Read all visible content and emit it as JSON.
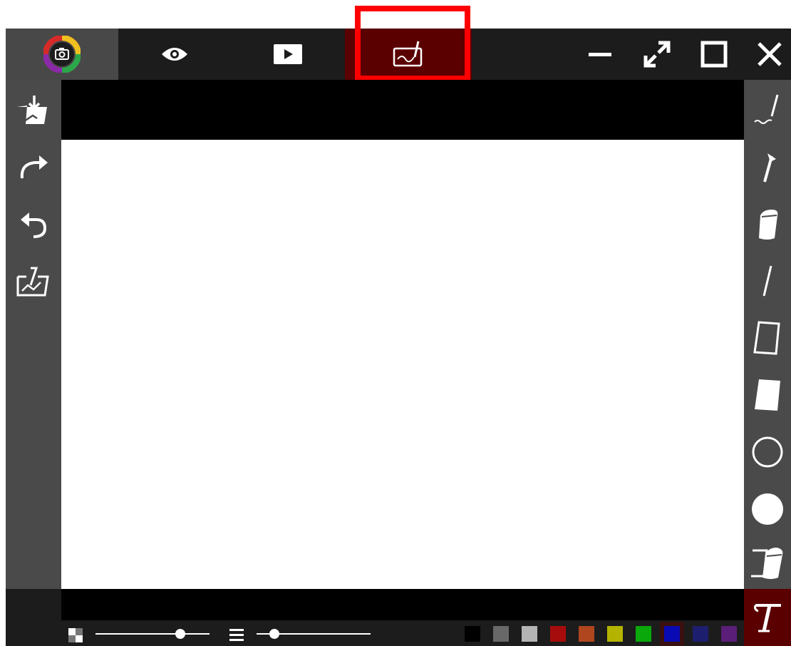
{
  "titlebar": {
    "tabs": [
      {
        "icon": "camera-logo-icon",
        "active": false
      },
      {
        "icon": "eye-icon",
        "active": false
      },
      {
        "icon": "play-icon",
        "active": false
      },
      {
        "icon": "drawing-board-icon",
        "active": true
      }
    ],
    "window_controls": [
      "minimize-icon",
      "expand-icon",
      "maximize-icon",
      "close-icon"
    ]
  },
  "left_toolbar": [
    "save-drawing-icon",
    "redo-icon",
    "undo-icon",
    "import-image-icon"
  ],
  "right_toolbar": [
    "freehand-pen-icon",
    "arrow-icon",
    "highlighter-icon",
    "line-icon",
    "rectangle-outline-icon",
    "rectangle-filled-icon",
    "ellipse-outline-icon",
    "ellipse-filled-icon",
    "eraser-icon",
    "text-icon"
  ],
  "status_bar": {
    "opacity_slider": {
      "icon": "checkerboard-icon",
      "value": 0.77
    },
    "width_slider": {
      "icon": "line-width-icon",
      "value": 0.12
    }
  },
  "palette": {
    "colors": [
      "#000000",
      "#686868",
      "#b4b4b4",
      "#a60c0c",
      "#b0461e",
      "#b4b400",
      "#0aa80a",
      "#0a0ab4",
      "#1e1e6e",
      "#5a1e78"
    ],
    "selected": "#0a0ab4",
    "accent": "#ff0000",
    "active_tab": "#5a0000"
  }
}
